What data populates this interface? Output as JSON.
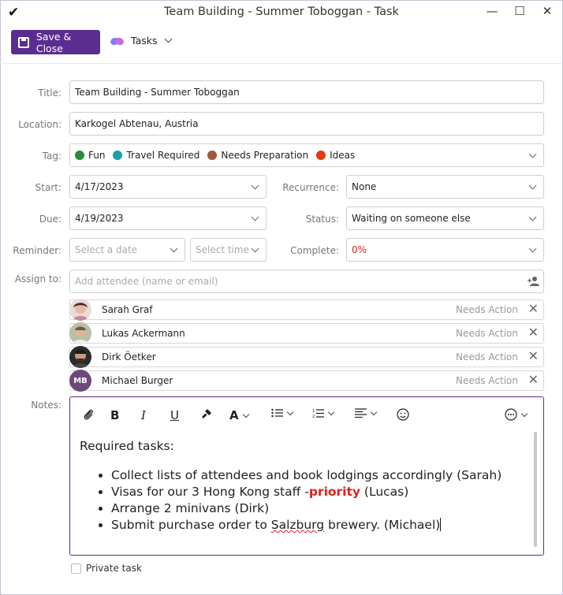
{
  "window": {
    "title": "Team Building - Summer Toboggan - Task",
    "minimize_icon": "—",
    "maximize_icon": "☐",
    "close_icon": "✕"
  },
  "toolbar": {
    "save_label": "Save & Close",
    "tasks_label": "Tasks"
  },
  "form": {
    "title_label": "Title:",
    "title_value": "Team Building - Summer Toboggan",
    "location_label": "Location:",
    "location_value": "Karkogel Abtenau, Austria",
    "tag_label": "Tag:",
    "tags": [
      {
        "label": "Fun",
        "color": "#2e8b3d"
      },
      {
        "label": "Travel Required",
        "color": "#17a2a8"
      },
      {
        "label": "Needs Preparation",
        "color": "#a0573a"
      },
      {
        "label": "Ideas",
        "color": "#e23a12"
      }
    ],
    "start_label": "Start:",
    "start_value": "4/17/2023",
    "due_label": "Due:",
    "due_value": "4/19/2023",
    "reminder_label": "Reminder:",
    "reminder_date_placeholder": "Select a date",
    "reminder_time_placeholder": "Select time",
    "recurrence_label": "Recurrence:",
    "recurrence_value": "None",
    "status_label": "Status:",
    "status_value": "Waiting on someone else",
    "complete_label": "Complete:",
    "complete_value": "0%",
    "complete_color": "#d3261c",
    "assign_label": "Assign to:",
    "assign_placeholder": "Add attendee (name or email)"
  },
  "attendees": [
    {
      "name": "Sarah Graf",
      "status": "Needs Action"
    },
    {
      "name": "Lukas Ackermann",
      "status": "Needs Action"
    },
    {
      "name": "Dirk Öetker",
      "status": "Needs Action"
    },
    {
      "name": "Michael Burger",
      "status": "Needs Action",
      "initials": "MB"
    }
  ],
  "notes": {
    "label": "Notes:",
    "heading": "Required tasks:",
    "items": {
      "i1": "Collect lists of attendees and book lodgings accordingly (Sarah)",
      "i2_pre": "Visas for our 3 Hong Kong staff -",
      "i2_bold": "priority",
      "i2_post": " (Lucas)",
      "i3": "Arrange 2 minivans (Dirk)",
      "i4_pre": "Submit purchase order to ",
      "i4_mis": "Salzburg",
      "i4_post": " brewery. (Michael)"
    }
  },
  "private_label": "Private task",
  "accent_color": "#5b2d90"
}
